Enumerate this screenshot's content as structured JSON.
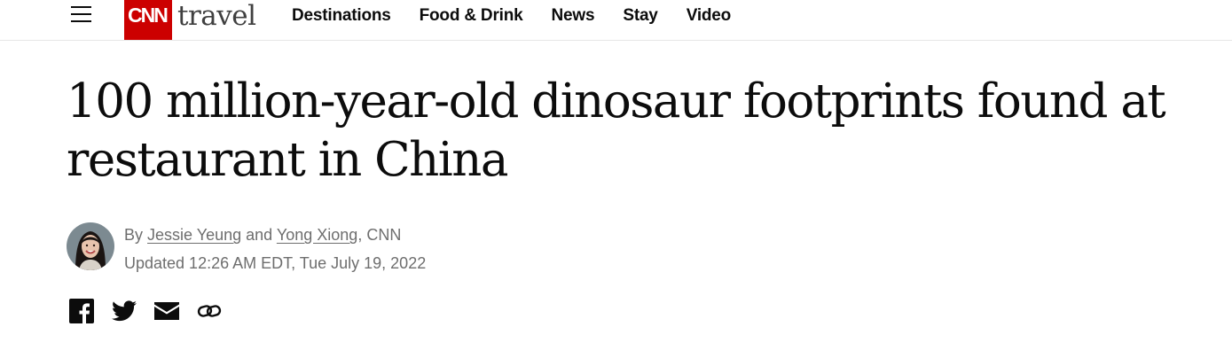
{
  "header": {
    "menu_icon": "hamburger-menu-icon",
    "logo": {
      "brand": "CNN",
      "section": "travel",
      "brand_color": "#cc0000"
    },
    "nav": [
      {
        "label": "Destinations"
      },
      {
        "label": "Food & Drink"
      },
      {
        "label": "News"
      },
      {
        "label": "Stay"
      },
      {
        "label": "Video"
      }
    ]
  },
  "article": {
    "headline": "100 million-year-old dinosaur footprints found at restaurant in China",
    "byline": {
      "prefix": "By",
      "author1": "Jessie Yeung",
      "conjunction": "and",
      "author2": "Yong Xiong",
      "outlet": ", CNN"
    },
    "updated": "Updated 12:26 AM EDT, Tue July 19, 2022"
  },
  "share": {
    "icons": [
      "facebook-icon",
      "twitter-icon",
      "email-icon",
      "link-icon"
    ]
  }
}
